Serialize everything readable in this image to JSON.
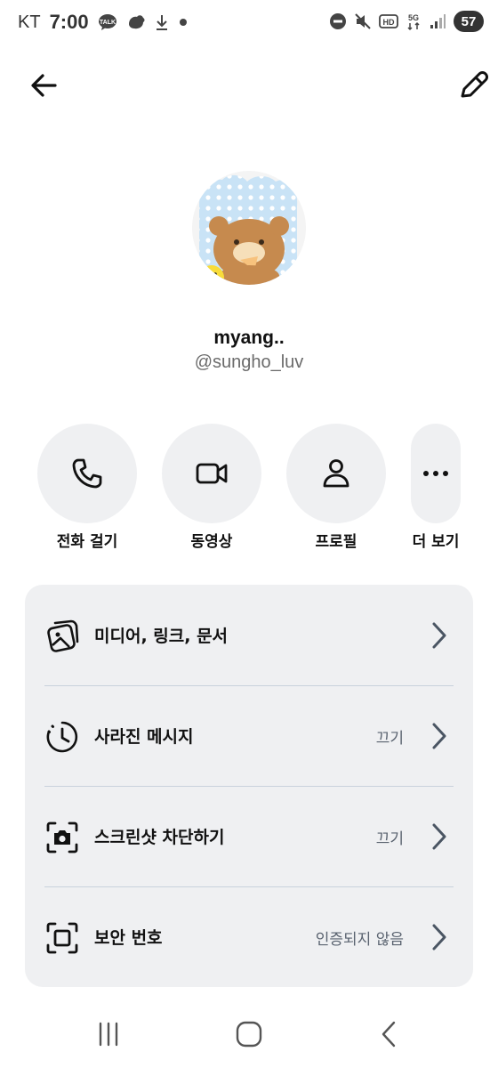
{
  "status_bar": {
    "carrier": "KT",
    "time": "7:00",
    "battery": "57",
    "notif_icons": [
      "talk-icon",
      "bird-icon",
      "download-icon",
      "dot-icon"
    ],
    "status_icons": [
      "dnd-icon",
      "mute-icon",
      "hd-icon",
      "5g-icon",
      "signal-icon"
    ]
  },
  "header": {
    "back_icon": "arrow-left-icon",
    "edit_icon": "pencil-icon"
  },
  "profile": {
    "name": "myang..",
    "handle": "@sungho_luv"
  },
  "actions": [
    {
      "label": "전화 걸기",
      "icon": "phone-icon"
    },
    {
      "label": "동영상",
      "icon": "video-icon"
    },
    {
      "label": "프로필",
      "icon": "person-icon"
    },
    {
      "label": "더 보기",
      "icon": "more-icon"
    }
  ],
  "settings": [
    {
      "title": "미디어, 링크, 문서",
      "value": "",
      "icon": "media-icon"
    },
    {
      "title": "사라진 메시지",
      "value": "끄기",
      "icon": "timer-icon"
    },
    {
      "title": "스크린샷 차단하기",
      "value": "끄기",
      "icon": "screenshot-icon"
    },
    {
      "title": "보안 번호",
      "value": "인증되지 않음",
      "icon": "safety-number-icon"
    }
  ],
  "colors": {
    "card_bg": "#eff0f2",
    "accent_text": "#5a6370",
    "divider": "#c9d2dc"
  },
  "nav": [
    "recents-icon",
    "home-icon",
    "back-nav-icon"
  ]
}
